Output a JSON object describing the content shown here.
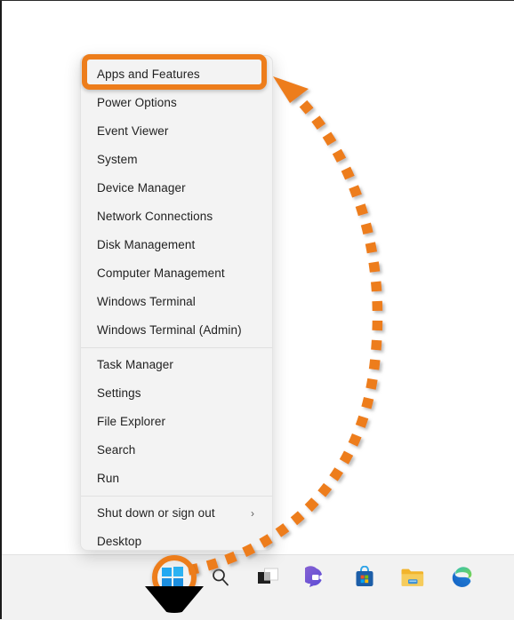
{
  "screen": {
    "background": "#ffffff",
    "accent_orange": "#ED7D1B"
  },
  "context_menu": {
    "name": "Windows power user menu",
    "groups": [
      {
        "items": [
          {
            "label": "Apps and Features",
            "icon": "",
            "submenu": false,
            "highlighted": true
          },
          {
            "label": "Power Options",
            "icon": "",
            "submenu": false,
            "highlighted": false
          },
          {
            "label": "Event Viewer",
            "icon": "",
            "submenu": false,
            "highlighted": false
          },
          {
            "label": "System",
            "icon": "",
            "submenu": false,
            "highlighted": false
          },
          {
            "label": "Device Manager",
            "icon": "",
            "submenu": false,
            "highlighted": false
          },
          {
            "label": "Network Connections",
            "icon": "",
            "submenu": false,
            "highlighted": false
          },
          {
            "label": "Disk Management",
            "icon": "",
            "submenu": false,
            "highlighted": false
          },
          {
            "label": "Computer Management",
            "icon": "",
            "submenu": false,
            "highlighted": false
          },
          {
            "label": "Windows Terminal",
            "icon": "",
            "submenu": false,
            "highlighted": false
          },
          {
            "label": "Windows Terminal (Admin)",
            "icon": "",
            "submenu": false,
            "highlighted": false
          }
        ]
      },
      {
        "items": [
          {
            "label": "Task Manager",
            "icon": "",
            "submenu": false,
            "highlighted": false
          },
          {
            "label": "Settings",
            "icon": "",
            "submenu": false,
            "highlighted": false
          },
          {
            "label": "File Explorer",
            "icon": "",
            "submenu": false,
            "highlighted": false
          },
          {
            "label": "Search",
            "icon": "",
            "submenu": false,
            "highlighted": false
          },
          {
            "label": "Run",
            "icon": "",
            "submenu": false,
            "highlighted": false
          }
        ]
      },
      {
        "items": [
          {
            "label": "Shut down or sign out",
            "icon": "chevron-right-icon",
            "submenu": true,
            "highlighted": false
          },
          {
            "label": "Desktop",
            "icon": "",
            "submenu": false,
            "highlighted": false
          }
        ]
      }
    ]
  },
  "taskbar": {
    "background": "#f2f2f2",
    "items": [
      {
        "name": "start-button",
        "icon": "windows-logo-icon",
        "tooltip": "Start"
      },
      {
        "name": "search-button",
        "icon": "search-icon",
        "tooltip": "Search"
      },
      {
        "name": "task-view-button",
        "icon": "task-view-icon",
        "tooltip": "Task View"
      },
      {
        "name": "chat-button",
        "icon": "chat-teams-icon",
        "tooltip": "Chat"
      },
      {
        "name": "store-button",
        "icon": "microsoft-store-icon",
        "tooltip": "Microsoft Store"
      },
      {
        "name": "file-explorer-button",
        "icon": "file-explorer-icon",
        "tooltip": "File Explorer"
      },
      {
        "name": "edge-button",
        "icon": "microsoft-edge-icon",
        "tooltip": "Microsoft Edge"
      }
    ]
  },
  "annotations": {
    "highlight_rect": {
      "name": "apps-and-features-highlight",
      "color": "#ED7D1B",
      "target_label": "Apps and Features"
    },
    "highlight_circle": {
      "name": "start-button-highlight",
      "color": "#ED7D1B",
      "target_label": "Start"
    },
    "arrow": {
      "name": "dashed-curved-arrow",
      "color": "#ED7D1B",
      "style": "dashed-square-dots",
      "points_from": "Start button",
      "points_to": "Apps and Features"
    },
    "cursor": {
      "name": "mouse-pointer-marker",
      "color": "#000000"
    }
  }
}
